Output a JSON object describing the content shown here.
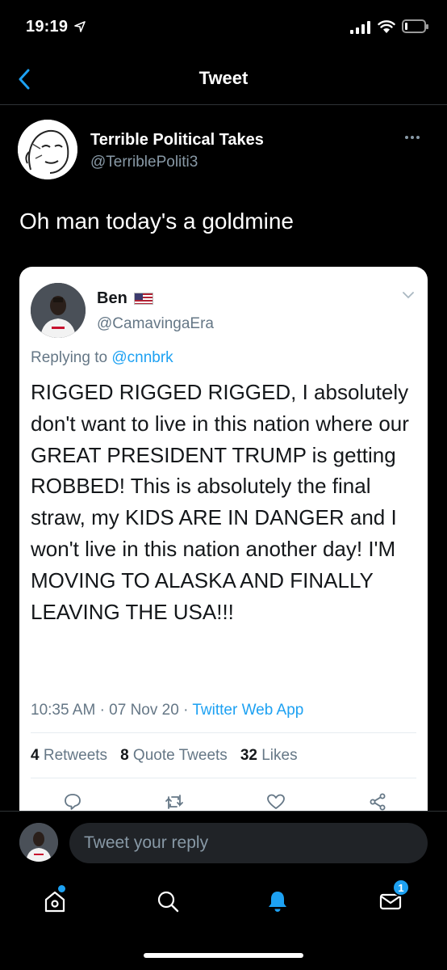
{
  "status_bar": {
    "time": "19:19",
    "battery_percent": 8
  },
  "nav": {
    "title": "Tweet"
  },
  "tweet": {
    "author_name": "Terrible Political Takes",
    "author_handle": "@TerriblePoliti3",
    "text": "Oh man today's a goldmine"
  },
  "quoted": {
    "name": "Ben",
    "handle": "@CamavingaEra",
    "replying_prefix": "Replying to",
    "replying_to": "@cnnbrk",
    "text": "RIGGED RIGGED RIGGED, I absolutely don't want to live in this nation where our GREAT PRESIDENT TRUMP is getting ROBBED! This is absolutely the final straw, my KIDS ARE IN DANGER and I won't live in this nation another day! I'M MOVING TO ALASKA AND FINALLY LEAVING THE USA!!!",
    "time": "10:35 AM",
    "date": "07 Nov 20",
    "separator": "·",
    "app": "Twitter Web App",
    "stats": {
      "retweets_count": "4",
      "retweets_label": "Retweets",
      "quotes_count": "8",
      "quotes_label": "Quote Tweets",
      "likes_count": "32",
      "likes_label": "Likes"
    }
  },
  "reply": {
    "placeholder": "Tweet your reply"
  },
  "tabbar": {
    "messages_badge": "1"
  },
  "colors": {
    "accent": "#1da1f2",
    "background": "#000000",
    "muted": "#8899a6"
  },
  "icons": [
    "back-chevron-icon",
    "more-icon",
    "reply-icon",
    "retweet-icon",
    "like-icon",
    "share-icon",
    "home-icon",
    "search-icon",
    "notifications-bell-icon",
    "messages-icon"
  ]
}
